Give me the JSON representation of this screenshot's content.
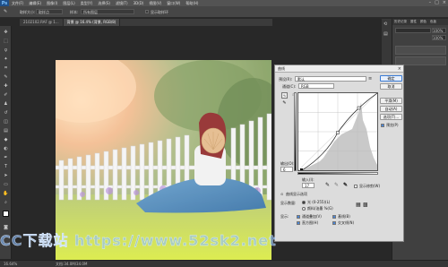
{
  "app": {
    "logo": "Ps"
  },
  "menubar": {
    "items": [
      "文件(F)",
      "编辑(E)",
      "图像(I)",
      "图层(L)",
      "类型(Y)",
      "选择(S)",
      "滤镜(T)",
      "3D(D)",
      "视图(V)",
      "窗口(W)",
      "帮助(H)"
    ],
    "controls": {
      "minimize": "–",
      "maximize": "□",
      "close": "×"
    }
  },
  "optionsbar": {
    "sample_size_label": "取样大小:",
    "sample_size_value": "取样点",
    "sample_label": "样本:",
    "sample_value": "所有图层",
    "show_ring_label": "显示取样环"
  },
  "tabs": [
    {
      "label": "2102102.RAF @ 1...",
      "active": false
    },
    {
      "label": "背景 @ 16.4% (背景, RGB/8)",
      "active": true
    }
  ],
  "statusbar": {
    "zoom": "16.64%",
    "doc": "文档:34.0M/34.0M"
  },
  "panel": {
    "tabs": [
      "历史记录",
      "属性",
      "颜色",
      "色板"
    ],
    "field_value": "",
    "opacity_value": "100%",
    "fill_value": "100%"
  },
  "dialog": {
    "title": "曲线",
    "preset_label": "预设(R):",
    "preset_value": "默认",
    "channel_label": "通道(C):",
    "channel_value": "RGB",
    "buttons": {
      "ok": "确定",
      "cancel": "取消",
      "smooth": "平滑(M)",
      "auto": "自动(A)",
      "options": "选项(T)..."
    },
    "preview_label": "预览(P)",
    "output_label": "输出(O):",
    "output_value": "6",
    "input_label": "输入(I):",
    "input_value": "17",
    "clipping_label": "显示修剪(W)",
    "curve_options_label": "曲线显示选项",
    "show_amount_label": "显示数量:",
    "light_label": "光 (0-255)(L)",
    "pigment_label": "颜料/油墨 %(G)",
    "show_label": "显示:",
    "show_opts": [
      "通道叠加(V)",
      "基线(B)",
      "直方图(H)",
      "交叉线(N)"
    ]
  },
  "watermark": "CC下载站 https://www.52sk2.net"
}
